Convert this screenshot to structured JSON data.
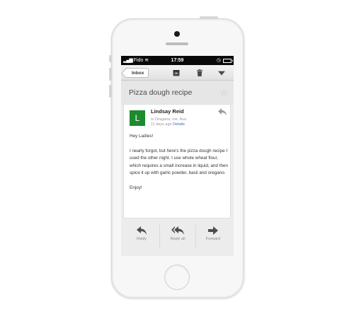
{
  "status_bar": {
    "carrier": "Fido",
    "time": "17:59"
  },
  "toolbar": {
    "back_label": "Inbox",
    "icons": [
      "archive-icon",
      "trash-icon",
      "dropdown-triangle-icon"
    ]
  },
  "email": {
    "subject": "Pizza dough recipe",
    "sender_initial": "L",
    "sender_name": "Lindsay Reid",
    "recipients": "to Dragana, me, Ava",
    "age": "11 days ago",
    "details_link": "Details",
    "body": [
      "Hey Ladies!",
      "I nearly forgot, but here's the pizza dough recipe I used the other night. I use whole wheat flour, which requires a small increase in liquid, and then spice it up with garlic powder, basil and oregano.",
      "Enjoy!"
    ]
  },
  "actions": {
    "reply": "Reply",
    "reply_all": "Reply all",
    "forward": "Forward"
  },
  "colors": {
    "avatar": "#1c8a2e",
    "link": "#3b6fc4"
  }
}
